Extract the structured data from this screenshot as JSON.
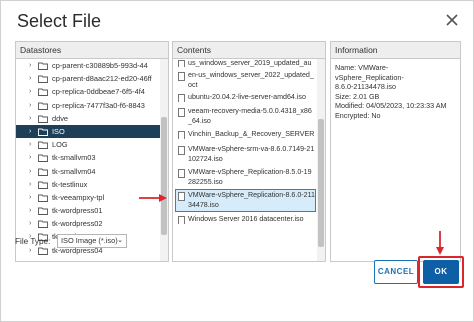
{
  "dialog": {
    "title": "Select File"
  },
  "datastores": {
    "header": "Datastores",
    "items": [
      {
        "label": "cp-parent-c30889b5-993d-44",
        "selected": false
      },
      {
        "label": "cp-parent-d8aac212-ed20-46ff",
        "selected": false
      },
      {
        "label": "cp-replica-0ddbeae7-6f5-4f4",
        "selected": false
      },
      {
        "label": "cp-replica-7477f3a0-f6-8843",
        "selected": false
      },
      {
        "label": "ddve",
        "selected": false
      },
      {
        "label": "ISO",
        "selected": true
      },
      {
        "label": "LOG",
        "selected": false
      },
      {
        "label": "tk-smallvm03",
        "selected": false
      },
      {
        "label": "tk-smallvm04",
        "selected": false
      },
      {
        "label": "tk-testlinux",
        "selected": false
      },
      {
        "label": "tk-veeampxy-tpl",
        "selected": false
      },
      {
        "label": "tk-wordpress01",
        "selected": false
      },
      {
        "label": "tk-wordpress02",
        "selected": false
      },
      {
        "label": "tk-wordpress03",
        "selected": false
      },
      {
        "label": "tk-wordpress04",
        "selected": false
      }
    ]
  },
  "contents": {
    "header": "Contents",
    "files": [
      {
        "label": "us_windows_server_2019_updated_aug",
        "selected": false
      },
      {
        "label": "en-us_windows_server_2022_updated_oct",
        "selected": false
      },
      {
        "label": "ubuntu-20.04.2-live-server-amd64.iso",
        "selected": false
      },
      {
        "label": "veeam-recovery-media-5.0.0.4318_x86_64.iso",
        "selected": false
      },
      {
        "label": "Vinchin_Backup_&_Recovery_SERVER_V6",
        "selected": false
      },
      {
        "label": "VMWare-vSphere-srm-va-8.6.0.7149-21102724.iso",
        "selected": false
      },
      {
        "label": "VMWare-vSphere_Replication-8.5.0-19282255.iso",
        "selected": false
      },
      {
        "label": "VMWare-vSphere_Replication-8.6.0-21134478.iso",
        "selected": true
      },
      {
        "label": "Windows Server 2016 datacenter.iso",
        "selected": false
      }
    ]
  },
  "information": {
    "header": "Information",
    "lines": [
      "Name: VMWare-vSphere_Replication-",
      "8.6.0-21134478.iso",
      "Size: 2.01 GB",
      "Modified: 04/05/2023, 10:23:33 AM",
      "Encrypted: No"
    ]
  },
  "file_type": {
    "label": "File Type:",
    "selected": "ISO Image (*.iso)"
  },
  "buttons": {
    "cancel": "CANCEL",
    "ok": "OK"
  },
  "colors": {
    "selected_folder": "#1d3f57",
    "selected_file_bg": "#d6ecfa",
    "primary": "#0f5fa6",
    "annotation": "#d9272d"
  }
}
